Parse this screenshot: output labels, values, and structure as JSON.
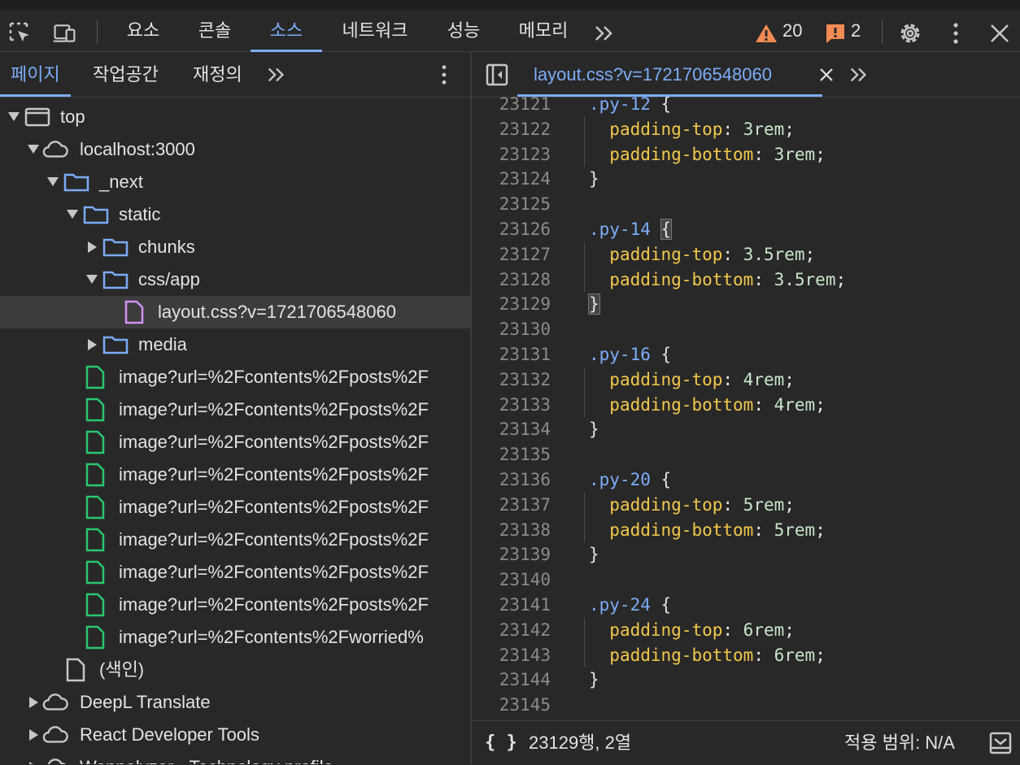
{
  "toolbar": {
    "tabs": [
      "요소",
      "콘솔",
      "소스",
      "네트워크",
      "성능",
      "메모리"
    ],
    "active_tab": "소스",
    "warnings": "20",
    "errors": "2"
  },
  "left_panel": {
    "tabs": [
      "페이지",
      "작업공간",
      "재정의"
    ],
    "tree": [
      {
        "label": "top"
      },
      {
        "label": "localhost:3000"
      },
      {
        "label": "_next"
      },
      {
        "label": "static"
      },
      {
        "label": "chunks"
      },
      {
        "label": "css/app"
      },
      {
        "label": "layout.css?v=1721706548060"
      },
      {
        "label": "media"
      },
      {
        "label": "image?url=%2Fcontents%2Fposts%2F"
      },
      {
        "label": "image?url=%2Fcontents%2Fposts%2F"
      },
      {
        "label": "image?url=%2Fcontents%2Fposts%2F"
      },
      {
        "label": "image?url=%2Fcontents%2Fposts%2F"
      },
      {
        "label": "image?url=%2Fcontents%2Fposts%2F"
      },
      {
        "label": "image?url=%2Fcontents%2Fposts%2F"
      },
      {
        "label": "image?url=%2Fcontents%2Fposts%2F"
      },
      {
        "label": "image?url=%2Fcontents%2Fposts%2F"
      },
      {
        "label": "image?url=%2Fcontents%2Fworried%"
      },
      {
        "label": "(색인)"
      },
      {
        "label": "DeepL Translate"
      },
      {
        "label": "React Developer Tools"
      },
      {
        "label": "Wappalyzer - Technology profile"
      }
    ]
  },
  "editor": {
    "file_tab": "layout.css?v=1721706548060",
    "lines": [
      {
        "n": "23121",
        "sel": ".py-12",
        "open": " {"
      },
      {
        "n": "23122",
        "prop": "padding-top",
        "val": "3rem"
      },
      {
        "n": "23123",
        "prop": "padding-bottom",
        "val": "3rem"
      },
      {
        "n": "23124",
        "close": "}"
      },
      {
        "n": "23125"
      },
      {
        "n": "23126",
        "sel": ".py-14",
        "open": " {"
      },
      {
        "n": "23127",
        "prop": "padding-top",
        "val": "3.5rem"
      },
      {
        "n": "23128",
        "prop": "padding-bottom",
        "val": "3.5rem"
      },
      {
        "n": "23129",
        "close": "}"
      },
      {
        "n": "23130"
      },
      {
        "n": "23131",
        "sel": ".py-16",
        "open": " {"
      },
      {
        "n": "23132",
        "prop": "padding-top",
        "val": "4rem"
      },
      {
        "n": "23133",
        "prop": "padding-bottom",
        "val": "4rem"
      },
      {
        "n": "23134",
        "close": "}"
      },
      {
        "n": "23135"
      },
      {
        "n": "23136",
        "sel": ".py-20",
        "open": " {"
      },
      {
        "n": "23137",
        "prop": "padding-top",
        "val": "5rem"
      },
      {
        "n": "23138",
        "prop": "padding-bottom",
        "val": "5rem"
      },
      {
        "n": "23139",
        "close": "}"
      },
      {
        "n": "23140"
      },
      {
        "n": "23141",
        "sel": ".py-24",
        "open": " {"
      },
      {
        "n": "23142",
        "prop": "padding-top",
        "val": "6rem"
      },
      {
        "n": "23143",
        "prop": "padding-bottom",
        "val": "6rem"
      },
      {
        "n": "23144",
        "close": "}"
      },
      {
        "n": "23145"
      }
    ]
  },
  "status": {
    "braces": "{ }",
    "position": "23129행, 2열",
    "coverage": "적용 범위: N/A"
  }
}
